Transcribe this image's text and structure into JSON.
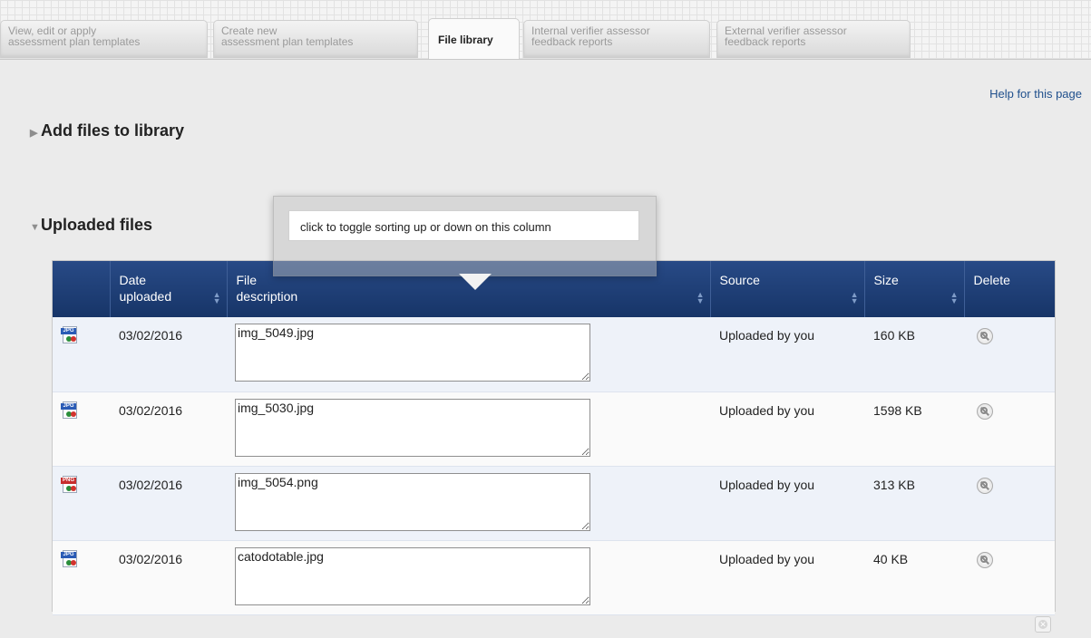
{
  "tabs": [
    {
      "line1": "View, edit or apply",
      "line2": "assessment plan templates"
    },
    {
      "line1": "Create new",
      "line2": "assessment plan templates"
    },
    {
      "line1": "File library",
      "line2": ""
    },
    {
      "line1": "Internal verifier assessor",
      "line2": "feedback reports"
    },
    {
      "line1": "External verifier assessor",
      "line2": "feedback reports"
    }
  ],
  "help_link": "Help for this page",
  "sections": {
    "add_files": "Add files to library",
    "uploaded": "Uploaded files"
  },
  "tooltip": "click to toggle sorting up or down on this column",
  "table": {
    "headers": {
      "date_l1": "Date",
      "date_l2": "uploaded",
      "desc_l1": "File",
      "desc_l2": "description",
      "source": "Source",
      "size": "Size",
      "delete": "Delete"
    },
    "rows": [
      {
        "icon": "jpg-file-icon",
        "badge": "JPG",
        "date": "03/02/2016",
        "description": "img_5049.jpg",
        "source": "Uploaded by you",
        "size": "160 KB"
      },
      {
        "icon": "jpg-file-icon",
        "badge": "JPG",
        "date": "03/02/2016",
        "description": "img_5030.jpg",
        "source": "Uploaded by you",
        "size": "1598 KB"
      },
      {
        "icon": "png-file-icon",
        "badge": "PNG",
        "date": "03/02/2016",
        "description": "img_5054.png",
        "source": "Uploaded by you",
        "size": "313 KB"
      },
      {
        "icon": "jpg-file-icon",
        "badge": "JPG",
        "date": "03/02/2016",
        "description": "catodotable.jpg",
        "source": "Uploaded by you",
        "size": "40 KB"
      }
    ]
  },
  "colors": {
    "header_bg": "#1f3f78",
    "jpg_badge": "#2a5bb5",
    "png_badge": "#c62d2d",
    "link": "#1f4f8c"
  }
}
